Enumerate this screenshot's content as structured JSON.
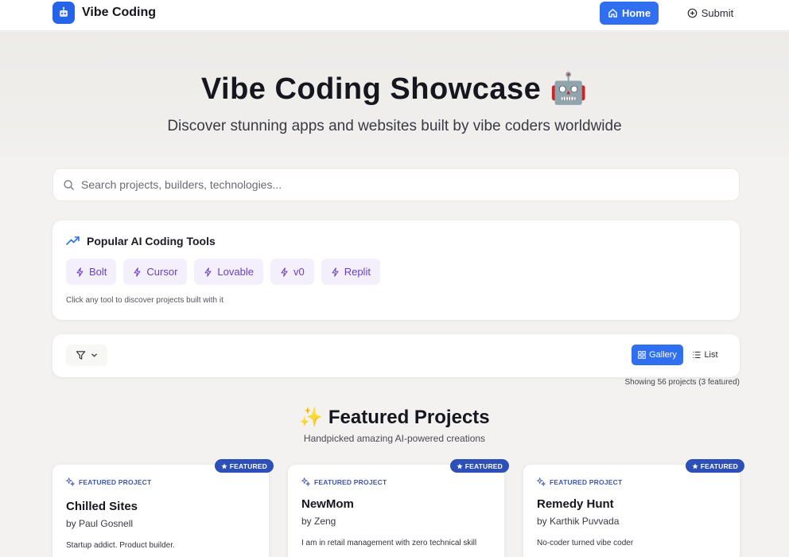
{
  "header": {
    "brand": "Vibe Coding",
    "logo_icon": "robot-icon",
    "nav": {
      "home_label": "Home",
      "submit_label": "Submit"
    }
  },
  "hero": {
    "title": "Vibe Coding Showcase 🤖",
    "subtitle": "Discover stunning apps and websites built by vibe coders worldwide"
  },
  "search": {
    "placeholder": "Search projects, builders, technologies..."
  },
  "tools": {
    "heading": "Popular AI Coding Tools",
    "items": [
      "Bolt",
      "Cursor",
      "Lovable",
      "v0",
      "Replit"
    ],
    "hint": "Click any tool to discover projects built with it"
  },
  "view": {
    "gallery_label": "Gallery",
    "list_label": "List",
    "selected": "Gallery"
  },
  "showing_text": "Showing 56 projects (3 featured)",
  "featured": {
    "title": "✨ Featured Projects",
    "subtitle": "Handpicked amazing AI-powered creations",
    "badge_label": "FEATURED",
    "tag_label": "FEATURED PROJECT",
    "projects": [
      {
        "name": "Chilled Sites",
        "author": "by Paul Gosnell",
        "description": "Startup addict. Product builder."
      },
      {
        "name": "NewMom",
        "author": "by Zeng",
        "description": "I am in retail management with zero technical skill"
      },
      {
        "name": "Remedy Hunt",
        "author": "by Karthik Puvvada",
        "description": "No-coder turned vibe coder"
      }
    ]
  },
  "colors": {
    "accent": "#2f6ff0",
    "chip_bg": "#f3effb",
    "chip_text": "#6b3fc4",
    "badge": "#2d4fb8"
  }
}
